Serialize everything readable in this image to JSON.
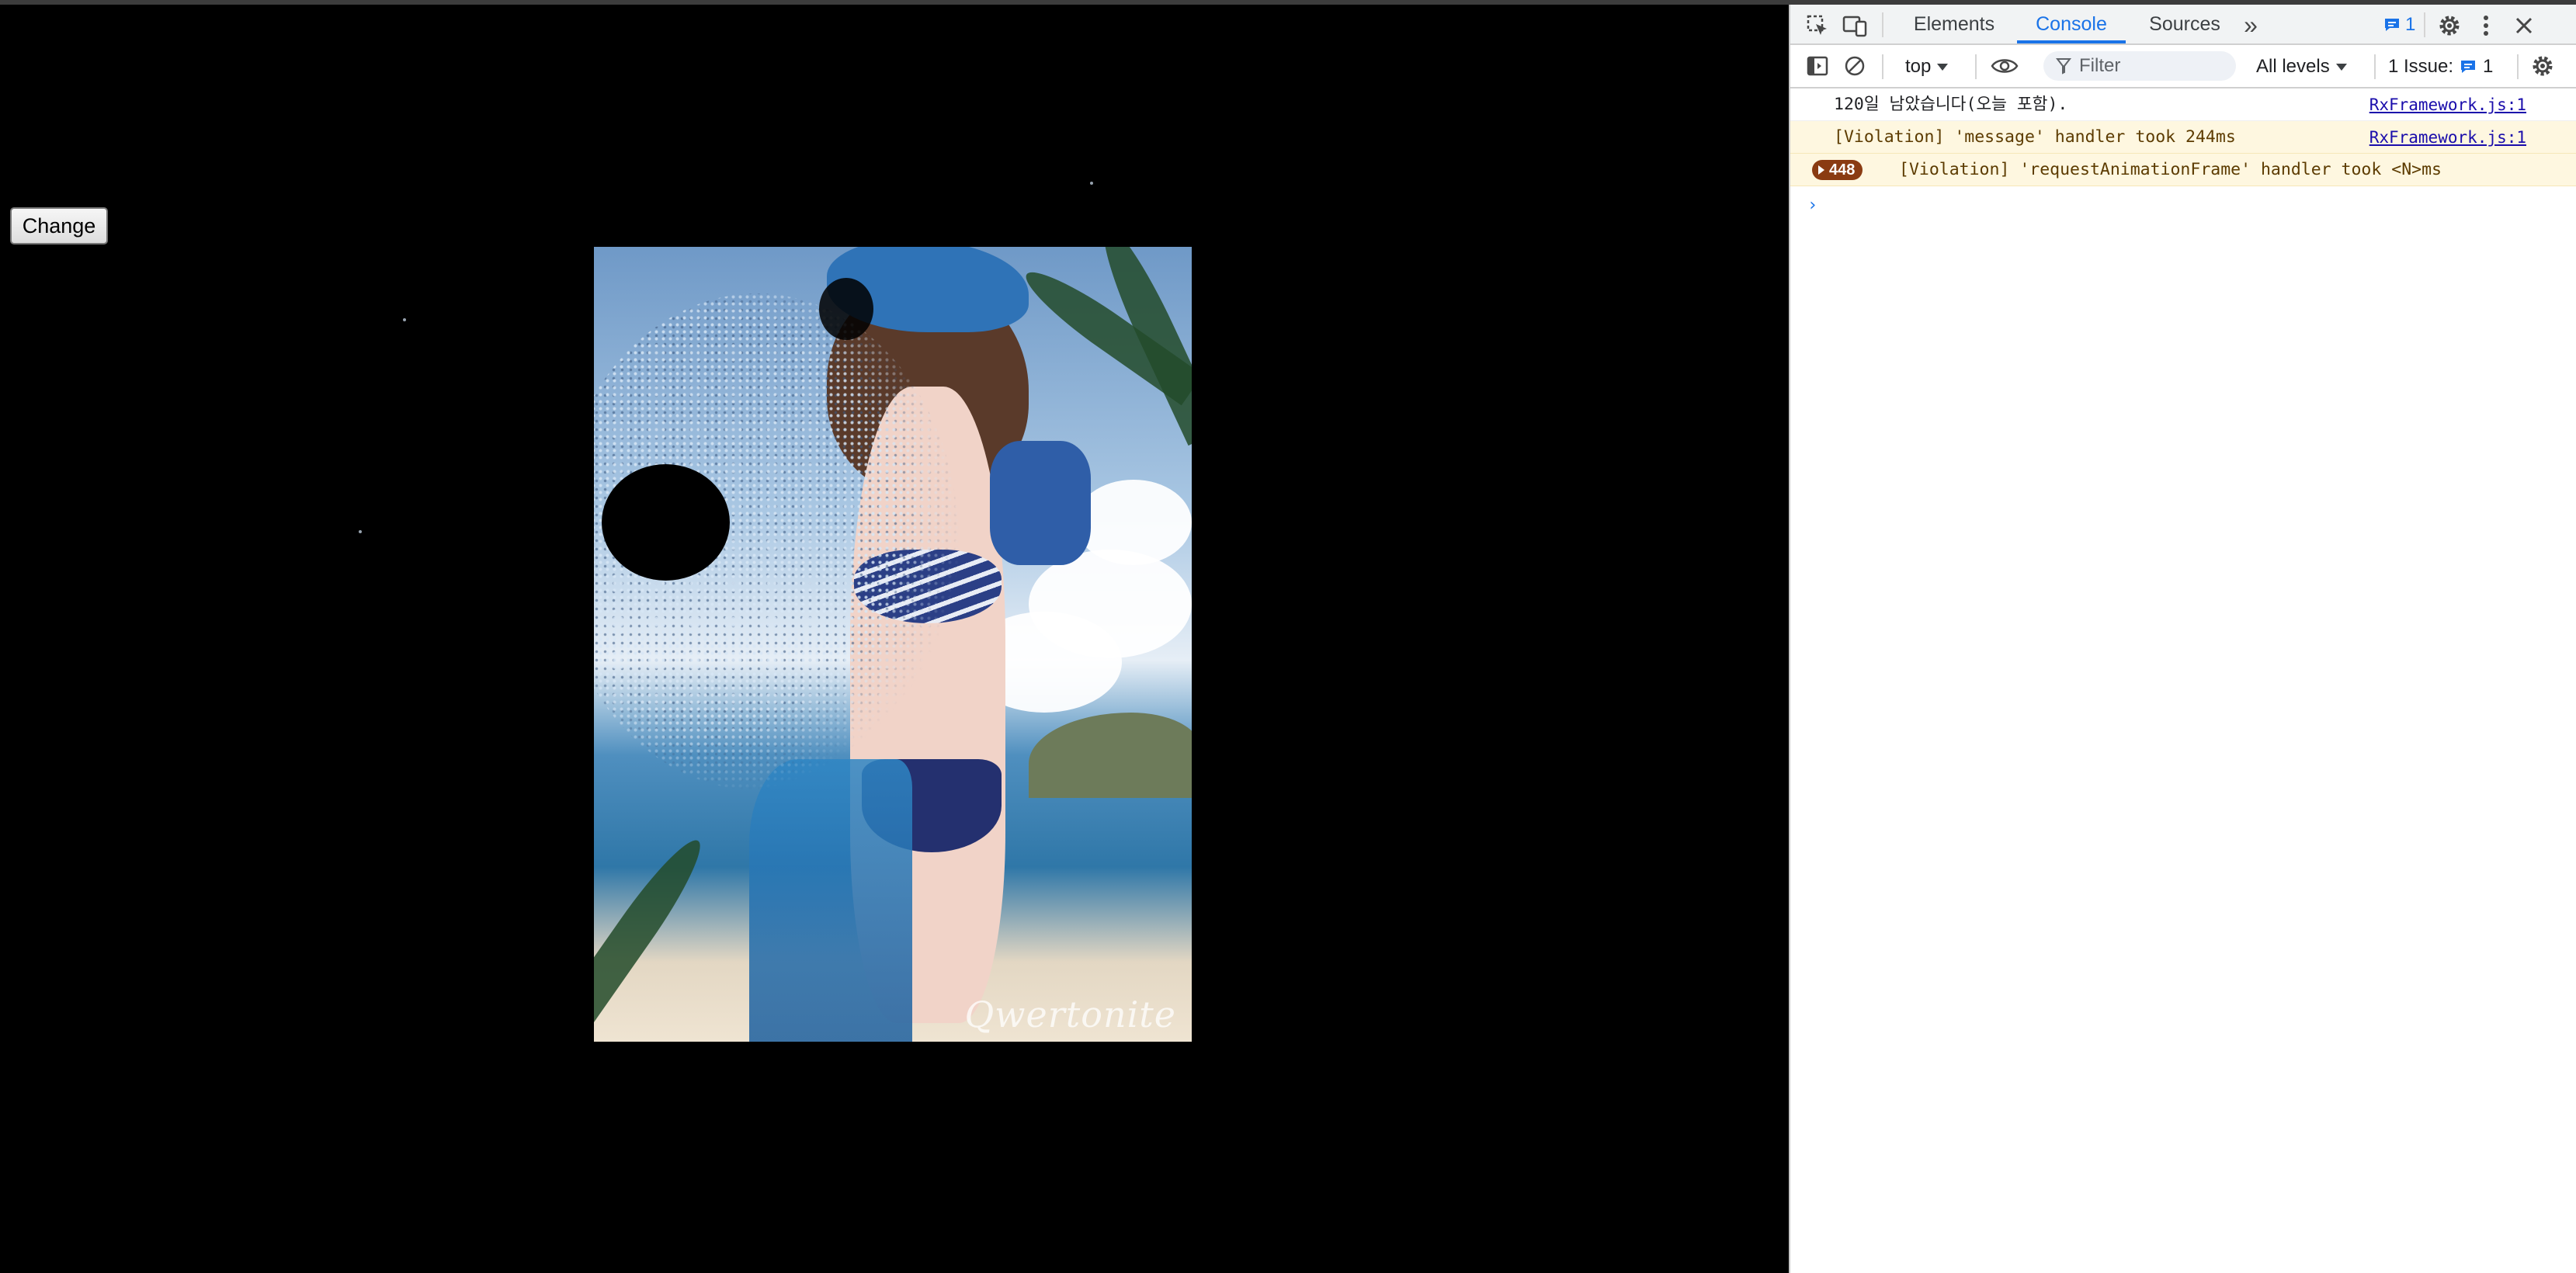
{
  "page": {
    "change_button_label": "Change",
    "artwork_signature": "Qwertonite"
  },
  "devtools": {
    "tabs": [
      {
        "label": "Elements",
        "active": false
      },
      {
        "label": "Console",
        "active": true
      },
      {
        "label": "Sources",
        "active": false
      }
    ],
    "more_tabs_glyph": "»",
    "messages_count": "1",
    "context_label": "top",
    "filter_placeholder": "Filter",
    "levels_label": "All levels",
    "issues_label": "1 Issue:",
    "issues_count": "1",
    "console": [
      {
        "type": "log",
        "text": "120일 남았습니다(오늘 포함).",
        "source": "RxFramework.js:1"
      },
      {
        "type": "violation",
        "text": "[Violation] 'message' handler took 244ms",
        "source": "RxFramework.js:1"
      },
      {
        "type": "violation-group",
        "count": "448",
        "text": "[Violation] 'requestAnimationFrame' handler took <N>ms"
      }
    ],
    "prompt_glyph": "›",
    "colors": {
      "accent": "#1a73e8",
      "warning_bg": "#fef7e0",
      "count_pill": "#8a3b12"
    },
    "icons": [
      "inspect-element-icon",
      "device-toolbar-icon",
      "more-tabs-icon",
      "message-icon",
      "settings-gear-icon",
      "kebab-menu-icon",
      "close-icon",
      "sidebar-toggle-icon",
      "clear-console-icon",
      "eye-icon",
      "filter-funnel-icon",
      "issue-message-icon",
      "console-settings-gear-icon"
    ]
  }
}
